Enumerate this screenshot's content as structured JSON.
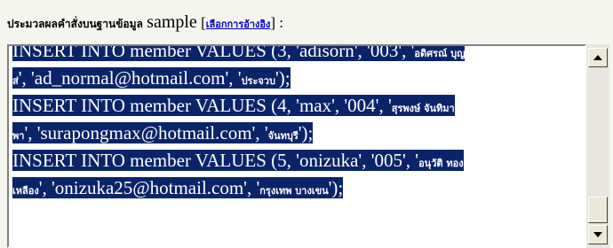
{
  "header": {
    "label_thai": "ประมวลผลคำสั่งบนฐานข้อมูล",
    "database": "sample",
    "open_bracket": "[",
    "link": "เลือกการอ้างอิง",
    "close": "] :"
  },
  "sql": {
    "line1": "INSERT INTO member VALUES (3, 'adisorn', '003', '",
    "line1_thai": "อดิศรณ์ บุญ",
    "line2_thai": "ส่",
    "line2": "', 'ad_normal@hotmail.com', '",
    "line2_thai_b": "ประจวบ",
    "line2_end": "');",
    "line3": "INSERT INTO member VALUES (4, 'max', '004', '",
    "line3_thai": "สุรพงษ์ จันทิมา",
    "line4_thai": "พา",
    "line4": "', 'surapongmax@hotmail.com', '",
    "line4_thai_b": "จันทบุรี",
    "line4_end": "');",
    "line5": "INSERT INTO member VALUES (5, 'onizuka', '005', '",
    "line5_thai": "อนุวัติ ทอง",
    "line6_thai": "เหลือง",
    "line6": "', 'onizuka25@hotmail.com', '",
    "line6_thai_b": "กรุงเทพ บางเขน",
    "line6_end": "');"
  },
  "colors": {
    "selection": "#0a246a",
    "link": "#0000cc"
  }
}
